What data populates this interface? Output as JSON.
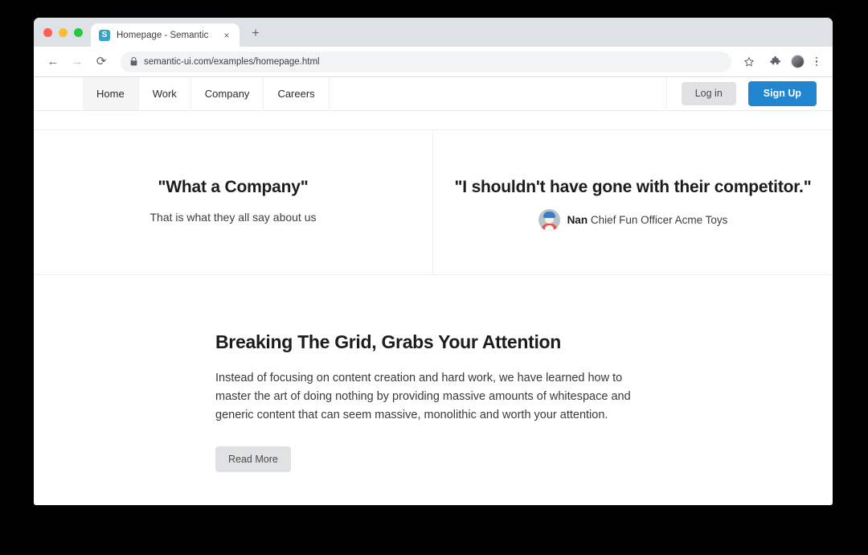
{
  "browser": {
    "tab": {
      "title": "Homepage - Semantic",
      "favicon_letter": "S",
      "favicon_color": "#35a3c7",
      "close_label": "×"
    },
    "new_tab_label": "+",
    "toolbar": {
      "back_label": "←",
      "forward_label": "→",
      "reload_label": "⟳",
      "url": "semantic-ui.com/examples/homepage.html",
      "lock_icon": "padlock-icon",
      "bookmark_icon": "star-icon",
      "extensions_icon": "puzzle-piece-icon",
      "profile_icon": "avatar-icon",
      "menu_icon": "kebab-menu-icon"
    }
  },
  "site": {
    "nav": {
      "items": [
        {
          "label": "Home",
          "active": true
        },
        {
          "label": "Work",
          "active": false
        },
        {
          "label": "Company",
          "active": false
        },
        {
          "label": "Careers",
          "active": false
        }
      ],
      "login_label": "Log in",
      "signup_label": "Sign Up",
      "signup_color": "#2185d0",
      "login_color": "#e0e1e2"
    },
    "quotes": [
      {
        "heading": "\"What a Company\"",
        "sub": "That is what they all say about us"
      },
      {
        "heading": "\"I shouldn't have gone with their competitor.\"",
        "attr_name": "Nan",
        "attr_role": "Chief Fun Officer Acme Toys"
      }
    ],
    "article": {
      "title": "Breaking The Grid, Grabs Your Attention",
      "body": "Instead of focusing on content creation and hard work, we have learned how to master the art of doing nothing by providing massive amounts of whitespace and generic content that can seem massive, monolithic and worth your attention.",
      "read_more_label": "Read More"
    }
  }
}
